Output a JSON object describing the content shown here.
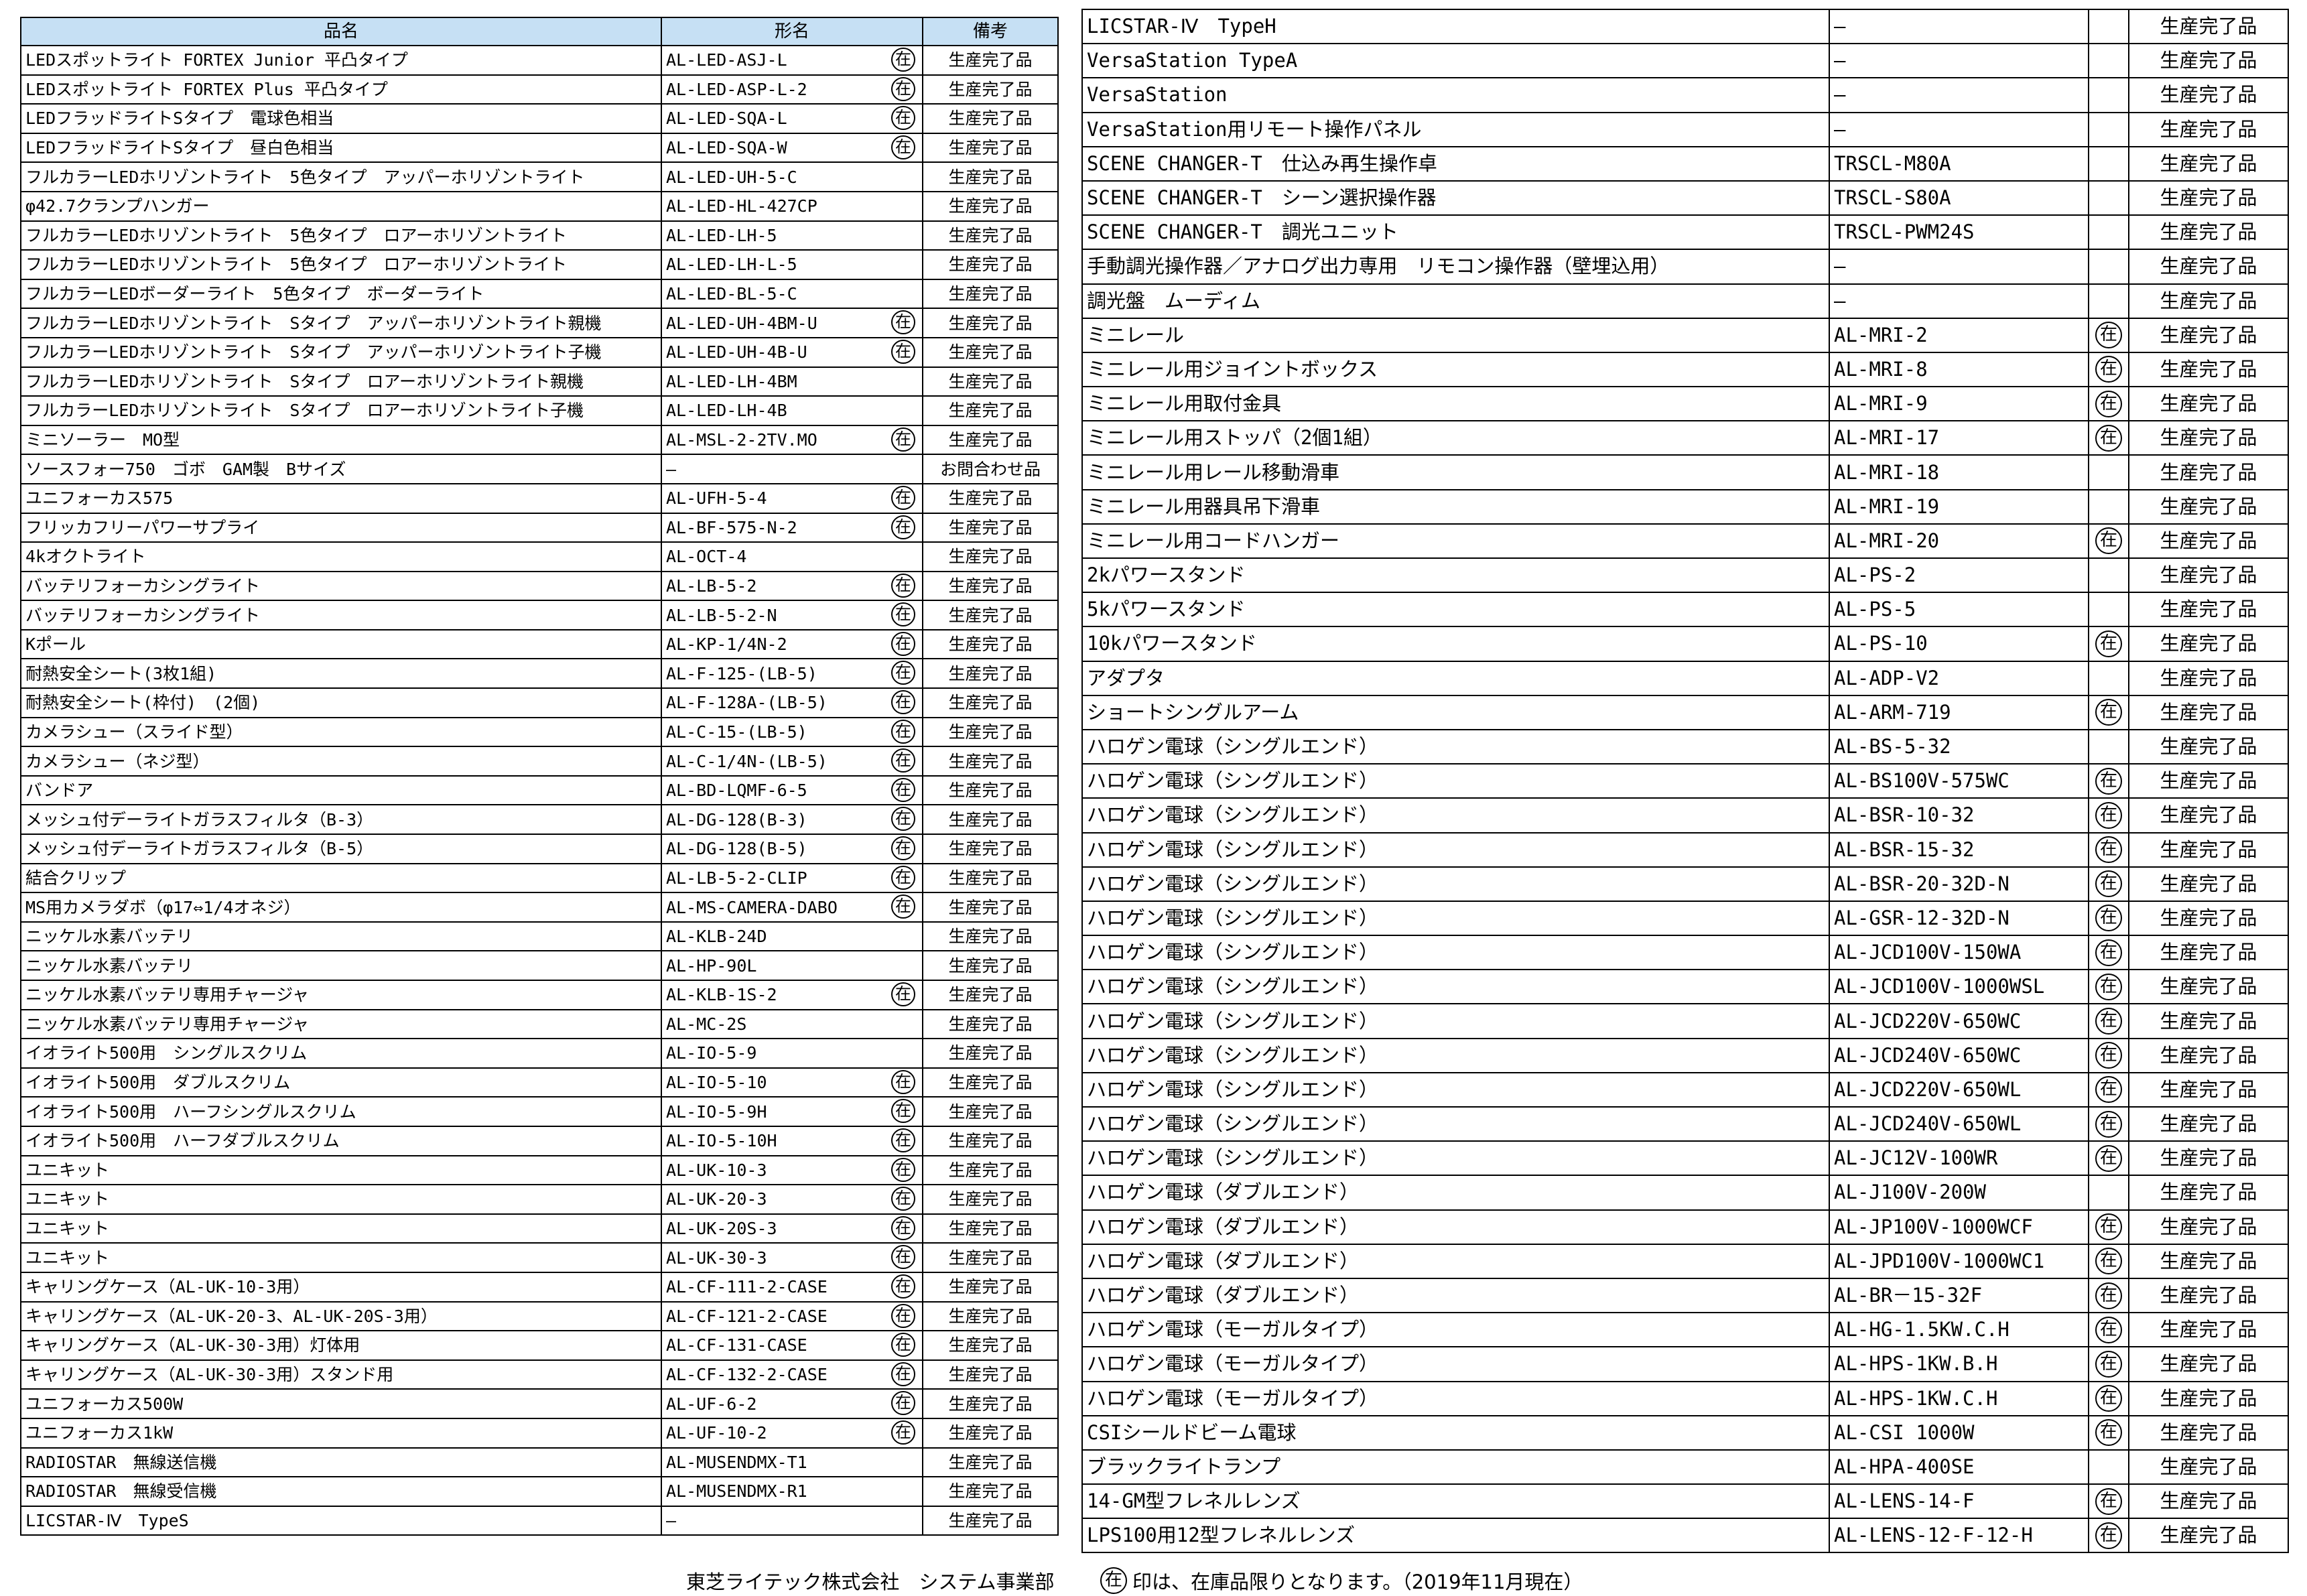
{
  "headers": {
    "name": "品名",
    "model": "形名",
    "note": "備考"
  },
  "mark": "在",
  "left_rows": [
    {
      "name": "LEDスポットライト FORTEX Junior 平凸タイプ",
      "model": "AL-LED-ASJ-L",
      "stock": true,
      "note": "生産完了品"
    },
    {
      "name": "LEDスポットライト FORTEX Plus 平凸タイプ",
      "model": "AL-LED-ASP-L-2",
      "stock": true,
      "note": "生産完了品"
    },
    {
      "name": "LEDフラッドライトSタイプ　電球色相当",
      "model": "AL-LED-SQA-L",
      "stock": true,
      "note": "生産完了品"
    },
    {
      "name": "LEDフラッドライトSタイプ　昼白色相当",
      "model": "AL-LED-SQA-W",
      "stock": true,
      "note": "生産完了品"
    },
    {
      "name": "フルカラーLEDホリゾントライト　5色タイプ　アッパーホリゾントライト",
      "model": "AL-LED-UH-5-C",
      "stock": false,
      "note": "生産完了品"
    },
    {
      "name": "φ42.7クランプハンガー",
      "model": "AL-LED-HL-427CP",
      "stock": false,
      "note": "生産完了品"
    },
    {
      "name": "フルカラーLEDホリゾントライト　5色タイプ　ロアーホリゾントライト",
      "model": "AL-LED-LH-5",
      "stock": false,
      "note": "生産完了品"
    },
    {
      "name": "フルカラーLEDホリゾントライト　5色タイプ　ロアーホリゾントライト",
      "model": "AL-LED-LH-L-5",
      "stock": false,
      "note": "生産完了品"
    },
    {
      "name": "フルカラーLEDボーダーライト　5色タイプ　ボーダーライト",
      "model": "AL-LED-BL-5-C",
      "stock": false,
      "note": "生産完了品"
    },
    {
      "name": "フルカラーLEDホリゾントライト　Sタイプ　アッパーホリゾントライト親機",
      "model": "AL-LED-UH-4BM-U",
      "stock": true,
      "note": "生産完了品"
    },
    {
      "name": "フルカラーLEDホリゾントライト　Sタイプ　アッパーホリゾントライト子機",
      "model": "AL-LED-UH-4B-U",
      "stock": true,
      "note": "生産完了品"
    },
    {
      "name": "フルカラーLEDホリゾントライト　Sタイプ　ロアーホリゾントライト親機",
      "model": "AL-LED-LH-4BM",
      "stock": false,
      "note": "生産完了品"
    },
    {
      "name": "フルカラーLEDホリゾントライト　Sタイプ　ロアーホリゾントライト子機",
      "model": "AL-LED-LH-4B",
      "stock": false,
      "note": "生産完了品"
    },
    {
      "name": "ミニソーラー　MO型",
      "model": "AL-MSL-2-2TV.MO",
      "stock": true,
      "note": "生産完了品"
    },
    {
      "name": "ソースフォー750　ゴボ　GAM製　Bサイズ",
      "model": "―",
      "stock": false,
      "note": "お問合わせ品"
    },
    {
      "name": "ユニフォーカス575",
      "model": "AL-UFH-5-4",
      "stock": true,
      "note": "生産完了品"
    },
    {
      "name": "フリッカフリーパワーサプライ",
      "model": "AL-BF-575-N-2",
      "stock": true,
      "note": "生産完了品"
    },
    {
      "name": "4kオクトライト",
      "model": "AL-OCT-4",
      "stock": false,
      "note": "生産完了品"
    },
    {
      "name": "バッテリフォーカシングライト",
      "model": "AL-LB-5-2",
      "stock": true,
      "note": "生産完了品"
    },
    {
      "name": "バッテリフォーカシングライト",
      "model": "AL-LB-5-2-N",
      "stock": true,
      "note": "生産完了品"
    },
    {
      "name": "Kポール",
      "model": "AL-KP-1/4N-2",
      "stock": true,
      "note": "生産完了品"
    },
    {
      "name": "耐熱安全シート(3枚1組)",
      "model": "AL-F-125-(LB-5)",
      "stock": true,
      "note": "生産完了品"
    },
    {
      "name": "耐熱安全シート(枠付)　(2個)",
      "model": "AL-F-128A-(LB-5)",
      "stock": true,
      "note": "生産完了品"
    },
    {
      "name": "カメラシュー（スライド型）",
      "model": "AL-C-15-(LB-5)",
      "stock": true,
      "note": "生産完了品"
    },
    {
      "name": "カメラシュー（ネジ型）",
      "model": "AL-C-1/4N-(LB-5)",
      "stock": true,
      "note": "生産完了品"
    },
    {
      "name": "バンドア",
      "model": "AL-BD-LQMF-6-5",
      "stock": true,
      "note": "生産完了品"
    },
    {
      "name": "メッシュ付デーライトガラスフィルタ（B-3）",
      "model": "AL-DG-128(B-3)",
      "stock": true,
      "note": "生産完了品"
    },
    {
      "name": "メッシュ付デーライトガラスフィルタ（B-5）",
      "model": "AL-DG-128(B-5)",
      "stock": true,
      "note": "生産完了品"
    },
    {
      "name": "結合クリップ",
      "model": "AL-LB-5-2-CLIP",
      "stock": true,
      "note": "生産完了品"
    },
    {
      "name": "MS用カメラダボ（φ17⇔1/4オネジ）",
      "model": "AL-MS-CAMERA-DABO",
      "stock": true,
      "note": "生産完了品"
    },
    {
      "name": "ニッケル水素バッテリ",
      "model": "AL-KLB-24D",
      "stock": false,
      "note": "生産完了品"
    },
    {
      "name": "ニッケル水素バッテリ",
      "model": "AL-HP-90L",
      "stock": false,
      "note": "生産完了品"
    },
    {
      "name": "ニッケル水素バッテリ専用チャージャ",
      "model": "AL-KLB-1S-2",
      "stock": true,
      "note": "生産完了品"
    },
    {
      "name": "ニッケル水素バッテリ専用チャージャ",
      "model": "AL-MC-2S",
      "stock": false,
      "note": "生産完了品"
    },
    {
      "name": "イオライト500用　シングルスクリム",
      "model": "AL-IO-5-9",
      "stock": false,
      "note": "生産完了品"
    },
    {
      "name": "イオライト500用　ダブルスクリム",
      "model": "AL-IO-5-10",
      "stock": true,
      "note": "生産完了品"
    },
    {
      "name": "イオライト500用　ハーフシングルスクリム",
      "model": "AL-IO-5-9H",
      "stock": true,
      "note": "生産完了品"
    },
    {
      "name": "イオライト500用　ハーフダブルスクリム",
      "model": "AL-IO-5-10H",
      "stock": true,
      "note": "生産完了品"
    },
    {
      "name": "ユニキット",
      "model": "AL-UK-10-3",
      "stock": true,
      "note": "生産完了品"
    },
    {
      "name": "ユニキット",
      "model": "AL-UK-20-3",
      "stock": true,
      "note": "生産完了品"
    },
    {
      "name": "ユニキット",
      "model": "AL-UK-20S-3",
      "stock": true,
      "note": "生産完了品"
    },
    {
      "name": "ユニキット",
      "model": "AL-UK-30-3",
      "stock": true,
      "note": "生産完了品"
    },
    {
      "name": "キャリングケース（AL-UK-10-3用）",
      "model": "AL-CF-111-2-CASE",
      "stock": true,
      "note": "生産完了品"
    },
    {
      "name": "キャリングケース（AL-UK-20-3、AL-UK-20S-3用）",
      "model": "AL-CF-121-2-CASE",
      "stock": true,
      "note": "生産完了品"
    },
    {
      "name": "キャリングケース（AL-UK-30-3用）灯体用",
      "model": "AL-CF-131-CASE",
      "stock": true,
      "note": "生産完了品"
    },
    {
      "name": "キャリングケース（AL-UK-30-3用）スタンド用",
      "model": "AL-CF-132-2-CASE",
      "stock": true,
      "note": "生産完了品"
    },
    {
      "name": "ユニフォーカス500W",
      "model": "AL-UF-6-2",
      "stock": true,
      "note": "生産完了品"
    },
    {
      "name": "ユニフォーカス1kW",
      "model": "AL-UF-10-2",
      "stock": true,
      "note": "生産完了品"
    },
    {
      "name": "RADIOSTAR　無線送信機",
      "model": "AL-MUSENDMX-T1",
      "stock": false,
      "note": "生産完了品"
    },
    {
      "name": "RADIOSTAR　無線受信機",
      "model": "AL-MUSENDMX-R1",
      "stock": false,
      "note": "生産完了品"
    },
    {
      "name": "LICSTAR-Ⅳ　TypeS",
      "model": "―",
      "stock": false,
      "note": "生産完了品"
    }
  ],
  "right_rows": [
    {
      "name": "LICSTAR-Ⅳ　TypeH",
      "model": "―",
      "stock": false,
      "note": "生産完了品"
    },
    {
      "name": "VersaStation TypeA",
      "model": "―",
      "stock": false,
      "note": "生産完了品"
    },
    {
      "name": "VersaStation",
      "model": "―",
      "stock": false,
      "note": "生産完了品"
    },
    {
      "name": "VersaStation用リモート操作パネル",
      "model": "―",
      "stock": false,
      "note": "生産完了品"
    },
    {
      "name": "SCENE CHANGER-T　仕込み再生操作卓",
      "model": "TRSCL-M80A",
      "stock": false,
      "note": "生産完了品"
    },
    {
      "name": "SCENE CHANGER-T　シーン選択操作器",
      "model": "TRSCL-S80A",
      "stock": false,
      "note": "生産完了品"
    },
    {
      "name": "SCENE CHANGER-T　調光ユニット",
      "model": "TRSCL-PWM24S",
      "stock": false,
      "note": "生産完了品"
    },
    {
      "name": "手動調光操作器／アナログ出力専用　リモコン操作器（壁埋込用）",
      "model": "―",
      "stock": false,
      "note": "生産完了品"
    },
    {
      "name": "調光盤　ムーディム",
      "model": "―",
      "stock": false,
      "note": "生産完了品"
    },
    {
      "name": "ミニレール",
      "model": "AL-MRI-2",
      "stock": true,
      "note": "生産完了品"
    },
    {
      "name": "ミニレール用ジョイントボックス",
      "model": "AL-MRI-8",
      "stock": true,
      "note": "生産完了品"
    },
    {
      "name": "ミニレール用取付金具",
      "model": "AL-MRI-9",
      "stock": true,
      "note": "生産完了品"
    },
    {
      "name": "ミニレール用ストッパ（2個1組）",
      "model": "AL-MRI-17",
      "stock": true,
      "note": "生産完了品"
    },
    {
      "name": "ミニレール用レール移動滑車",
      "model": "AL-MRI-18",
      "stock": false,
      "note": "生産完了品"
    },
    {
      "name": "ミニレール用器具吊下滑車",
      "model": "AL-MRI-19",
      "stock": false,
      "note": "生産完了品"
    },
    {
      "name": "ミニレール用コードハンガー",
      "model": "AL-MRI-20",
      "stock": true,
      "note": "生産完了品"
    },
    {
      "name": "2kパワースタンド",
      "model": "AL-PS-2",
      "stock": false,
      "note": "生産完了品"
    },
    {
      "name": "5kパワースタンド",
      "model": "AL-PS-5",
      "stock": false,
      "note": "生産完了品"
    },
    {
      "name": "10kパワースタンド",
      "model": "AL-PS-10",
      "stock": true,
      "note": "生産完了品"
    },
    {
      "name": "アダプタ",
      "model": "AL-ADP-V2",
      "stock": false,
      "note": "生産完了品"
    },
    {
      "name": "ショートシングルアーム",
      "model": "AL-ARM-719",
      "stock": true,
      "note": "生産完了品"
    },
    {
      "name": "ハロゲン電球（シングルエンド）",
      "model": "AL-BS-5-32",
      "stock": false,
      "note": "生産完了品"
    },
    {
      "name": "ハロゲン電球（シングルエンド）",
      "model": "AL-BS100V-575WC",
      "stock": true,
      "note": "生産完了品"
    },
    {
      "name": "ハロゲン電球（シングルエンド）",
      "model": "AL-BSR-10-32",
      "stock": true,
      "note": "生産完了品"
    },
    {
      "name": "ハロゲン電球（シングルエンド）",
      "model": "AL-BSR-15-32",
      "stock": true,
      "note": "生産完了品"
    },
    {
      "name": "ハロゲン電球（シングルエンド）",
      "model": "AL-BSR-20-32D-N",
      "stock": true,
      "note": "生産完了品"
    },
    {
      "name": "ハロゲン電球（シングルエンド）",
      "model": "AL-GSR-12-32D-N",
      "stock": true,
      "note": "生産完了品"
    },
    {
      "name": "ハロゲン電球（シングルエンド）",
      "model": "AL-JCD100V-150WA",
      "stock": true,
      "note": "生産完了品"
    },
    {
      "name": "ハロゲン電球（シングルエンド）",
      "model": "AL-JCD100V-1000WSL",
      "stock": true,
      "note": "生産完了品"
    },
    {
      "name": "ハロゲン電球（シングルエンド）",
      "model": "AL-JCD220V-650WC",
      "stock": true,
      "note": "生産完了品"
    },
    {
      "name": "ハロゲン電球（シングルエンド）",
      "model": "AL-JCD240V-650WC",
      "stock": true,
      "note": "生産完了品"
    },
    {
      "name": "ハロゲン電球（シングルエンド）",
      "model": "AL-JCD220V-650WL",
      "stock": true,
      "note": "生産完了品"
    },
    {
      "name": "ハロゲン電球（シングルエンド）",
      "model": "AL-JCD240V-650WL",
      "stock": true,
      "note": "生産完了品"
    },
    {
      "name": "ハロゲン電球（シングルエンド）",
      "model": "AL-JC12V-100WR",
      "stock": true,
      "note": "生産完了品"
    },
    {
      "name": "ハロゲン電球（ダブルエンド）",
      "model": "AL-J100V-200W",
      "stock": false,
      "note": "生産完了品"
    },
    {
      "name": "ハロゲン電球（ダブルエンド）",
      "model": "AL-JP100V-1000WCF",
      "stock": true,
      "note": "生産完了品"
    },
    {
      "name": "ハロゲン電球（ダブルエンド）",
      "model": "AL-JPD100V-1000WC1",
      "stock": true,
      "note": "生産完了品"
    },
    {
      "name": "ハロゲン電球（ダブルエンド）",
      "model": "AL-BR－15-32F",
      "stock": true,
      "note": "生産完了品"
    },
    {
      "name": "ハロゲン電球（モーガルタイプ）",
      "model": "AL-HG-1.5KW.C.H",
      "stock": true,
      "note": "生産完了品"
    },
    {
      "name": "ハロゲン電球（モーガルタイプ）",
      "model": "AL-HPS-1KW.B.H",
      "stock": true,
      "note": "生産完了品"
    },
    {
      "name": "ハロゲン電球（モーガルタイプ）",
      "model": "AL-HPS-1KW.C.H",
      "stock": true,
      "note": "生産完了品"
    },
    {
      "name": "CSIシールドビーム電球",
      "model": "AL-CSI 1000W",
      "stock": true,
      "note": "生産完了品"
    },
    {
      "name": "ブラックライトランプ",
      "model": "AL-HPA-400SE",
      "stock": false,
      "note": "生産完了品"
    },
    {
      "name": "14-GM型フレネルレンズ",
      "model": "AL-LENS-14-F",
      "stock": true,
      "note": "生産完了品"
    },
    {
      "name": "LPS100用12型フレネルレンズ",
      "model": "AL-LENS-12-F-12-H",
      "stock": true,
      "note": "生産完了品"
    }
  ],
  "footer": {
    "company": "東芝ライテック株式会社　システム事業部",
    "legend": "印は、在庫品限りとなります。（2019年11月現在）"
  }
}
